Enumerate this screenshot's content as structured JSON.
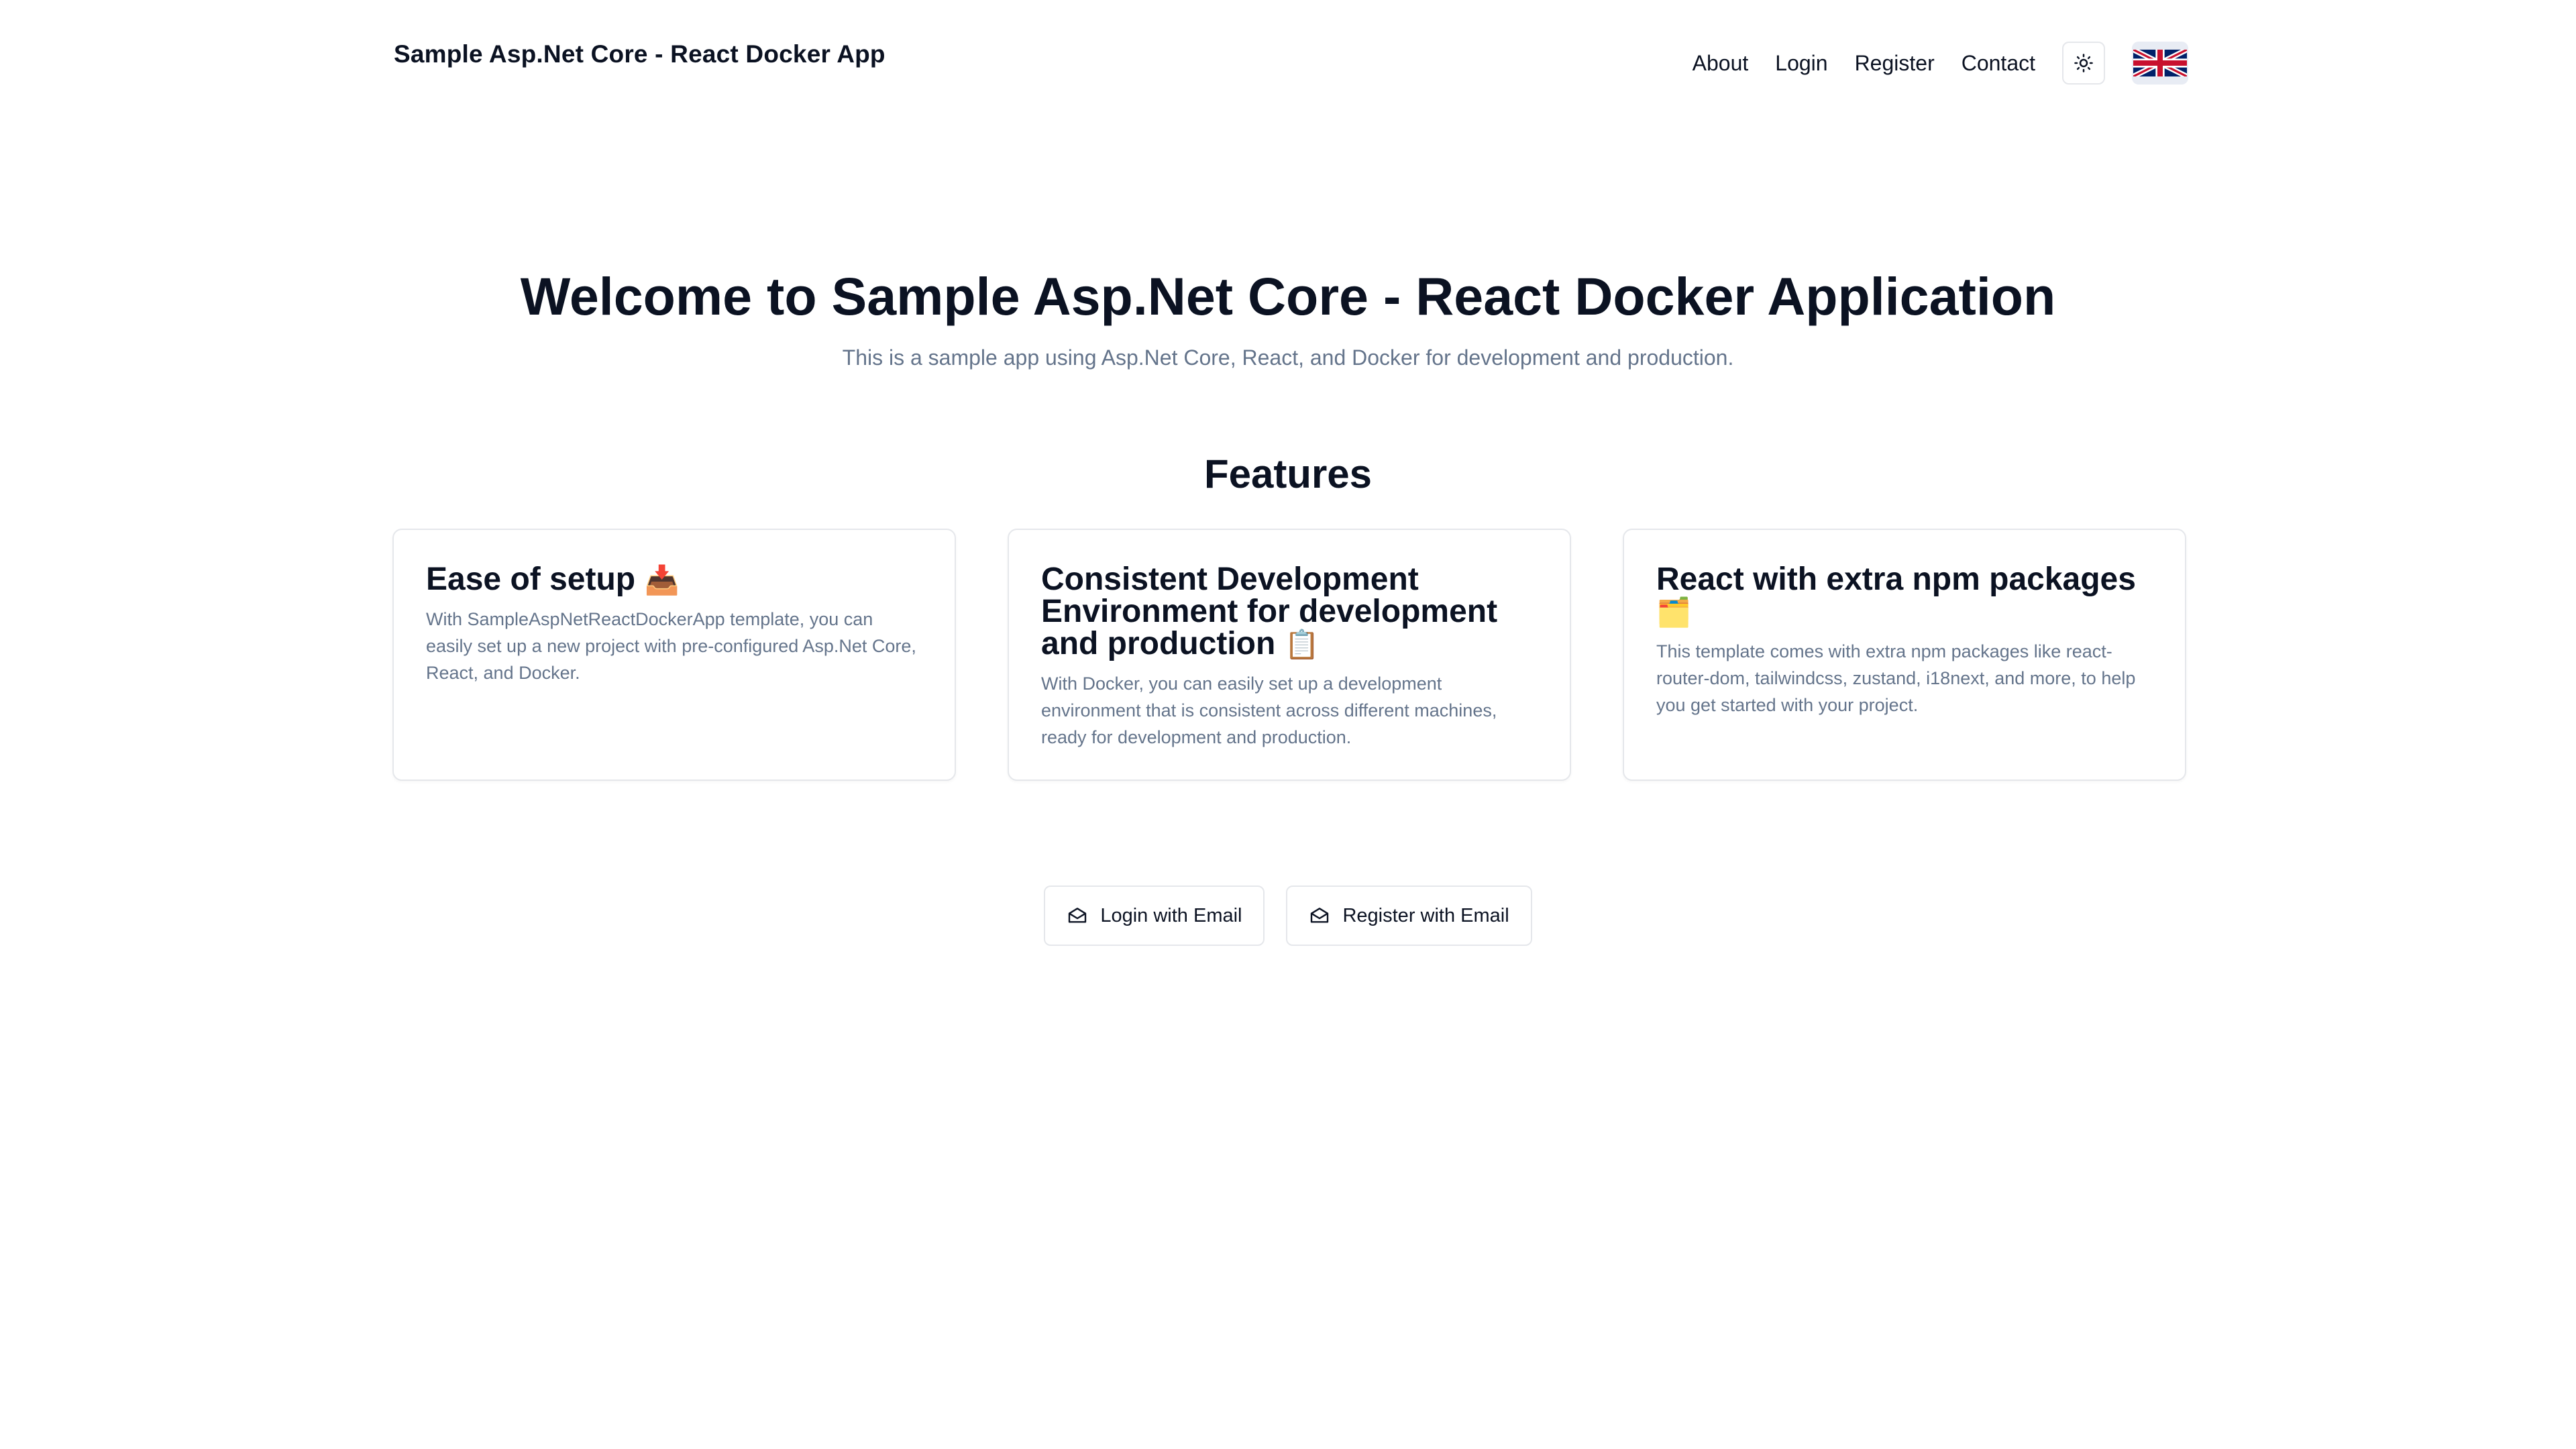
{
  "header": {
    "brand": "Sample Asp.Net Core - React Docker App",
    "nav": [
      {
        "label": "About"
      },
      {
        "label": "Login"
      },
      {
        "label": "Register"
      },
      {
        "label": "Contact"
      }
    ],
    "theme_toggle_icon": "sun-icon",
    "language_flag_icon": "uk-flag-icon"
  },
  "hero": {
    "title": "Welcome to Sample Asp.Net Core - React Docker Application",
    "subtitle": "This is a sample app using Asp.Net Core, React, and Docker for development and production."
  },
  "features": {
    "heading": "Features",
    "cards": [
      {
        "title": "Ease of setup",
        "emoji": "📥",
        "description": "With SampleAspNetReactDockerApp template, you can easily set up a new project with pre-configured Asp.Net Core, React, and Docker."
      },
      {
        "title": "Consistent Development Environment for development and production",
        "emoji": "📋",
        "description": "With Docker, you can easily set up a development environment that is consistent across different machines, ready for development and production."
      },
      {
        "title": "React with extra npm packages",
        "emoji": "🗂️",
        "description": "This template comes with extra npm packages like react-router-dom, tailwindcss, zustand, i18next, and more, to help you get started with your project."
      }
    ]
  },
  "actions": {
    "login_label": "Login with Email",
    "register_label": "Register with Email",
    "icon": "mail-open-icon"
  },
  "colors": {
    "text_primary": "#0b1222",
    "text_muted": "#64748b",
    "border": "#e5e7eb"
  }
}
